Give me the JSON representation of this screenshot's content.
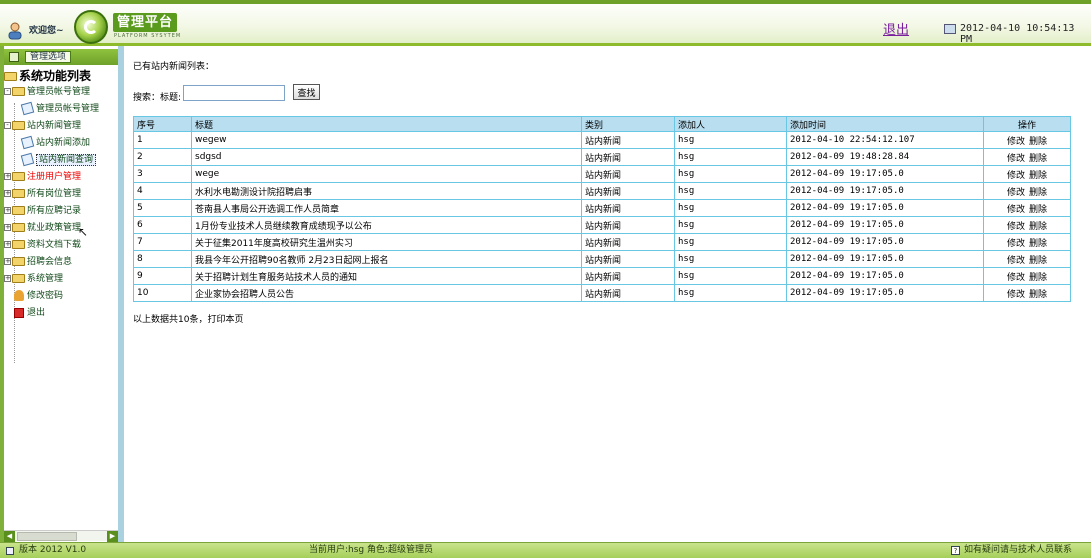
{
  "header": {
    "welcome": "欢迎您~",
    "logo_title": "管理平台",
    "logo_subtitle": "PLATFORM SYSYTEM",
    "logout": "退出",
    "datetime": "2012-04-10 10:54:13 PM"
  },
  "sidebar": {
    "header_button": "管理选项",
    "root": "系统功能列表",
    "items": [
      {
        "label": "管理员帐号管理"
      },
      {
        "label": "管理员帐号管理"
      },
      {
        "label": "站内新闻管理"
      },
      {
        "label": "站内新闻添加"
      },
      {
        "label": "站内新闻查询"
      },
      {
        "label": "注册用户管理"
      },
      {
        "label": "所有岗位管理"
      },
      {
        "label": "所有应聘记录"
      },
      {
        "label": "就业政策管理"
      },
      {
        "label": "资料文档下载"
      },
      {
        "label": "招聘会信息"
      },
      {
        "label": "系统管理"
      },
      {
        "label": "修改密码"
      },
      {
        "label": "退出"
      }
    ]
  },
  "main": {
    "title": "已有站内新闻列表：",
    "search_label": "搜索：标题:",
    "search_value": "",
    "search_button": "查找",
    "columns": [
      "序号",
      "标题",
      "类别",
      "添加人",
      "添加时间",
      "操作"
    ],
    "rows": [
      {
        "id": "1",
        "title": "wegew",
        "category": "站内新闻",
        "author": "hsg",
        "time": "2012-04-10 22:54:12.107"
      },
      {
        "id": "2",
        "title": "sdgsd",
        "category": "站内新闻",
        "author": "hsg",
        "time": "2012-04-09 19:48:28.84"
      },
      {
        "id": "3",
        "title": "wege",
        "category": "站内新闻",
        "author": "hsg",
        "time": "2012-04-09 19:17:05.0"
      },
      {
        "id": "4",
        "title": "水利水电勘测设计院招聘启事",
        "category": "站内新闻",
        "author": "hsg",
        "time": "2012-04-09 19:17:05.0"
      },
      {
        "id": "5",
        "title": "苍南县人事局公开选调工作人员简章",
        "category": "站内新闻",
        "author": "hsg",
        "time": "2012-04-09 19:17:05.0"
      },
      {
        "id": "6",
        "title": "1月份专业技术人员继续教育成绩现予以公布",
        "category": "站内新闻",
        "author": "hsg",
        "time": "2012-04-09 19:17:05.0"
      },
      {
        "id": "7",
        "title": "关于征集2011年度高校研究生温州实习",
        "category": "站内新闻",
        "author": "hsg",
        "time": "2012-04-09 19:17:05.0"
      },
      {
        "id": "8",
        "title": "我县今年公开招聘90名教师 2月23日起网上报名",
        "category": "站内新闻",
        "author": "hsg",
        "time": "2012-04-09 19:17:05.0"
      },
      {
        "id": "9",
        "title": "关于招聘计划生育服务站技术人员的通知",
        "category": "站内新闻",
        "author": "hsg",
        "time": "2012-04-09 19:17:05.0"
      },
      {
        "id": "10",
        "title": "企业家协会招聘人员公告",
        "category": "站内新闻",
        "author": "hsg",
        "time": "2012-04-09 19:17:05.0"
      }
    ],
    "edit_label": "修改",
    "delete_label": "删除",
    "summary": "以上数据共10条，打印本页"
  },
  "footer": {
    "version": "版本 2012 V1.0",
    "user_info": "当前用户:hsg  角色:超级管理员",
    "help": "如有疑问请与技术人员联系"
  }
}
